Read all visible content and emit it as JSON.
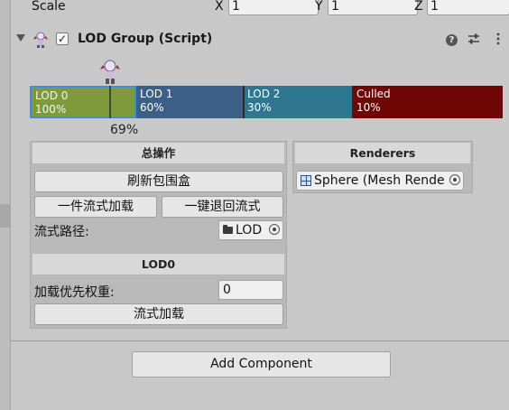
{
  "transform": {
    "scale_label": "Scale",
    "x_label": "X",
    "x_value": "1",
    "y_label": "Y",
    "y_value": "1",
    "z_label": "Z",
    "z_value": "1"
  },
  "component": {
    "title": "LOD Group (Script)",
    "enabled": "✓",
    "icons": [
      "foldout-arrow",
      "script-character-icon",
      "help-icon",
      "preset-sliders-icon",
      "kebab-menu-icon"
    ]
  },
  "lod_bar": {
    "segments": [
      {
        "name": "LOD 0",
        "percent": "100%"
      },
      {
        "name": "LOD 1",
        "percent": "60%"
      },
      {
        "name": "LOD 2",
        "percent": "30%"
      },
      {
        "name": "Culled",
        "percent": "10%"
      }
    ],
    "camera_percent": "69%",
    "colors": {
      "lod0": "#7f9a3a",
      "lod1": "#3b5f86",
      "lod2": "#2f7790",
      "culled": "#6e0606",
      "selected_border": "#3a8fe0"
    }
  },
  "ops_panel": {
    "title": "总操作",
    "refresh_bounds_label": "刷新包围盒",
    "stream_load_all_label": "一件流式加载",
    "revert_stream_label": "一键退回流式",
    "stream_path_label": "流式路径:",
    "stream_path_value": "LOD",
    "lod0_title": "LOD0",
    "load_priority_label": "加载优先权重:",
    "load_priority_value": "0",
    "stream_load_label": "流式加载"
  },
  "renderers_panel": {
    "title": "Renderers",
    "renderer_value": "Sphere (Mesh Renderer)"
  },
  "add_component_label": "Add Component"
}
